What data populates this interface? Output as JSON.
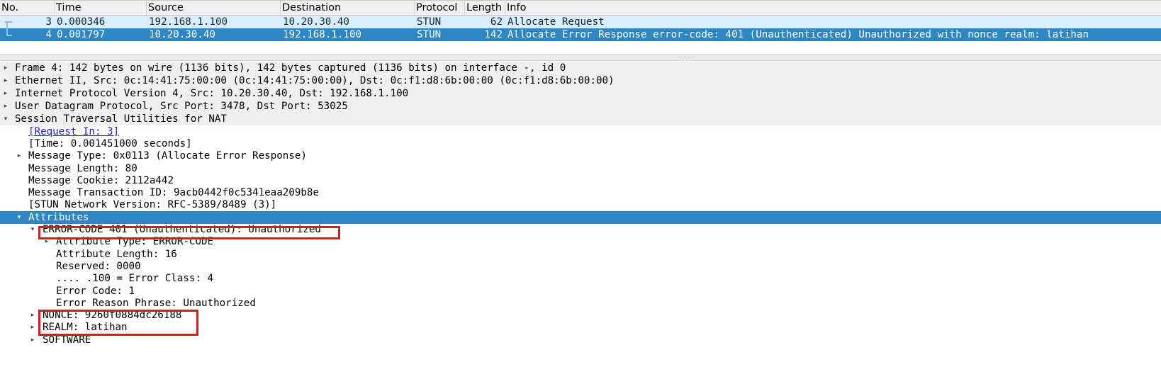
{
  "packet_list": {
    "columns": [
      "No.",
      "Time",
      "Source",
      "Destination",
      "Protocol",
      "Length",
      "Info"
    ],
    "rows": [
      {
        "no": "3",
        "time": "0.000346",
        "source": "192.168.1.100",
        "destination": "10.20.30.40",
        "protocol": "STUN",
        "length": "62",
        "info": "Allocate Request"
      },
      {
        "no": "4",
        "time": "0.001797",
        "source": "10.20.30.40",
        "destination": "192.168.1.100",
        "protocol": "STUN",
        "length": "142",
        "info": "Allocate Error Response error-code: 401 (Unauthenticated) Unauthorized with nonce realm: latihan"
      }
    ],
    "selected_row": "4"
  },
  "details": {
    "frame": "Frame 4: 142 bytes on wire (1136 bits), 142 bytes captured (1136 bits) on interface -, id 0",
    "ethernet": "Ethernet II, Src: 0c:14:41:75:00:00 (0c:14:41:75:00:00), Dst: 0c:f1:d8:6b:00:00 (0c:f1:d8:6b:00:00)",
    "ip": "Internet Protocol Version 4, Src: 10.20.30.40, Dst: 192.168.1.100",
    "udp": "User Datagram Protocol, Src Port: 3478, Dst Port: 53025",
    "stun": "Session Traversal Utilities for NAT",
    "request_in": "[Request In: 3]",
    "time": "[Time: 0.001451000 seconds]",
    "message_type": "Message Type: 0x0113 (Allocate Error Response)",
    "message_length": "Message Length: 80",
    "message_cookie": "Message Cookie: 2112a442",
    "transaction_id": "Message Transaction ID: 9acb0442f0c5341eaa209b8e",
    "network_version": "[STUN Network Version: RFC-5389/8489 (3)]",
    "attributes": "Attributes",
    "error_code": "ERROR-CODE 401 (Unauthenticated): Unauthorized",
    "attr_type": "Attribute Type: ERROR-CODE",
    "attr_length": "Attribute Length: 16",
    "reserved": "Reserved: 0000",
    "error_class": ".... .100 = Error Class: 4",
    "error_code_value": "Error Code: 1",
    "reason_phrase": "Error Reason Phrase: Unauthorized",
    "nonce": "NONCE: 9260f0884dc26188",
    "realm": "REALM: latihan",
    "software": "SOFTWARE"
  },
  "colors": {
    "selection": "#2e86c5",
    "related_row": "#daeeff",
    "highlight_box": "#e3141b",
    "link": "#1a1aff"
  }
}
